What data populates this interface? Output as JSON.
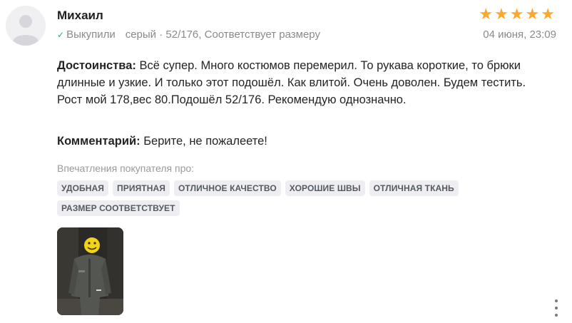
{
  "review": {
    "author": "Михаил",
    "verified_mark": "✓",
    "verified_label": "Выкупили",
    "variant": "серый · 52/176, Соответствует размеру",
    "rating": 5,
    "stars": [
      "★",
      "★",
      "★",
      "★",
      "★"
    ],
    "date": "04 июня, 23:09",
    "pros_label": "Достоинства:",
    "pros_text": "Всё супер. Много костюмов перемерил. То рукава короткие, то брюки длинные и узкие. И только этот подошёл. Как влитой. Очень доволен. Будем тестить. Рост мой 178,вес 80.Подошёл 52/176. Рекомендую однозначно.",
    "comment_label": "Комментарий:",
    "comment_text": "Берите, не пожалеете!",
    "impressions_label": "Впечатления покупателя про:",
    "tags": [
      "Удобная",
      "Приятная",
      "Отличное качество",
      "Хорошие швы",
      "Отличная ткань",
      "Размер соответствует"
    ]
  },
  "colors": {
    "star": "#ffa62b",
    "verified": "#26b061",
    "tag_bg": "#eeeef2",
    "muted_text": "#8a8a8a"
  },
  "icons": {
    "avatar": "user-avatar-placeholder-icon",
    "verified": "checkmark-icon",
    "star": "star-icon",
    "more": "more-vertical-icon",
    "photo_overlay": "smiley-face-icon"
  }
}
